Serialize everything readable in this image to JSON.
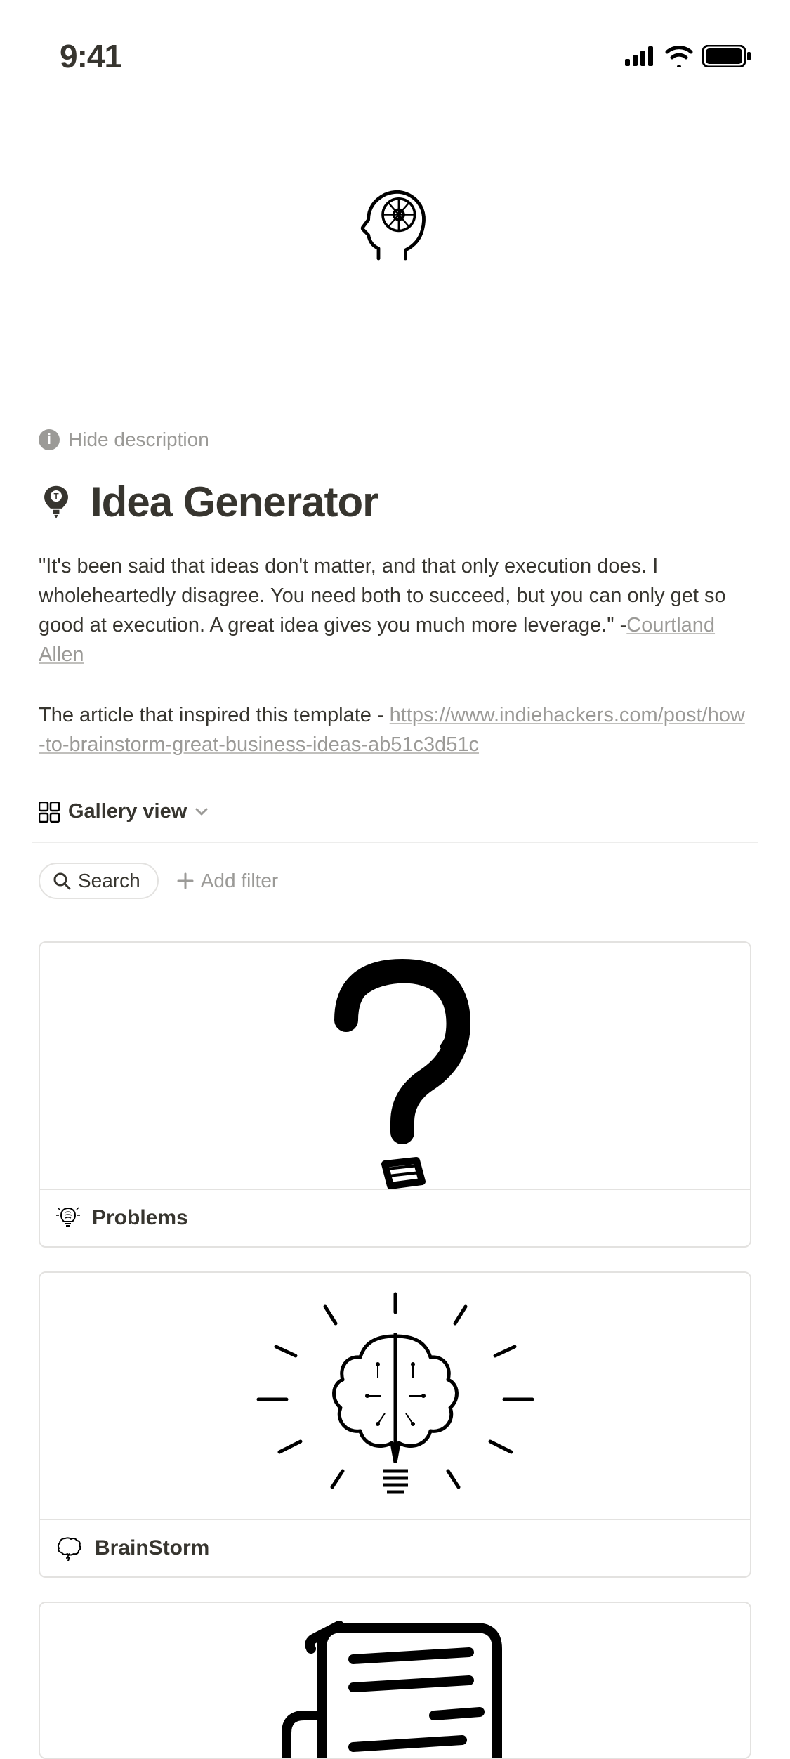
{
  "status": {
    "time": "9:41"
  },
  "hide_description_label": "Hide description",
  "page": {
    "title": "Idea Generator"
  },
  "quote": {
    "text": "\"It's been said that ideas don't matter, and that only execution does. I wholeheartedly disagree. You need both to succeed, but you can only get so good at execution. A great idea gives you much more leverage.\" -",
    "author": "Courtland Allen"
  },
  "article": {
    "prefix": "The article that inspired this template - ",
    "url": "https://www.indiehackers.com/post/how-to-brainstorm-great-business-ideas-ab51c3d51c"
  },
  "view": {
    "label": "Gallery view"
  },
  "toolbar": {
    "search_label": "Search",
    "add_filter_label": "Add filter"
  },
  "cards": [
    {
      "title": "Problems"
    },
    {
      "title": "BrainStorm"
    }
  ]
}
